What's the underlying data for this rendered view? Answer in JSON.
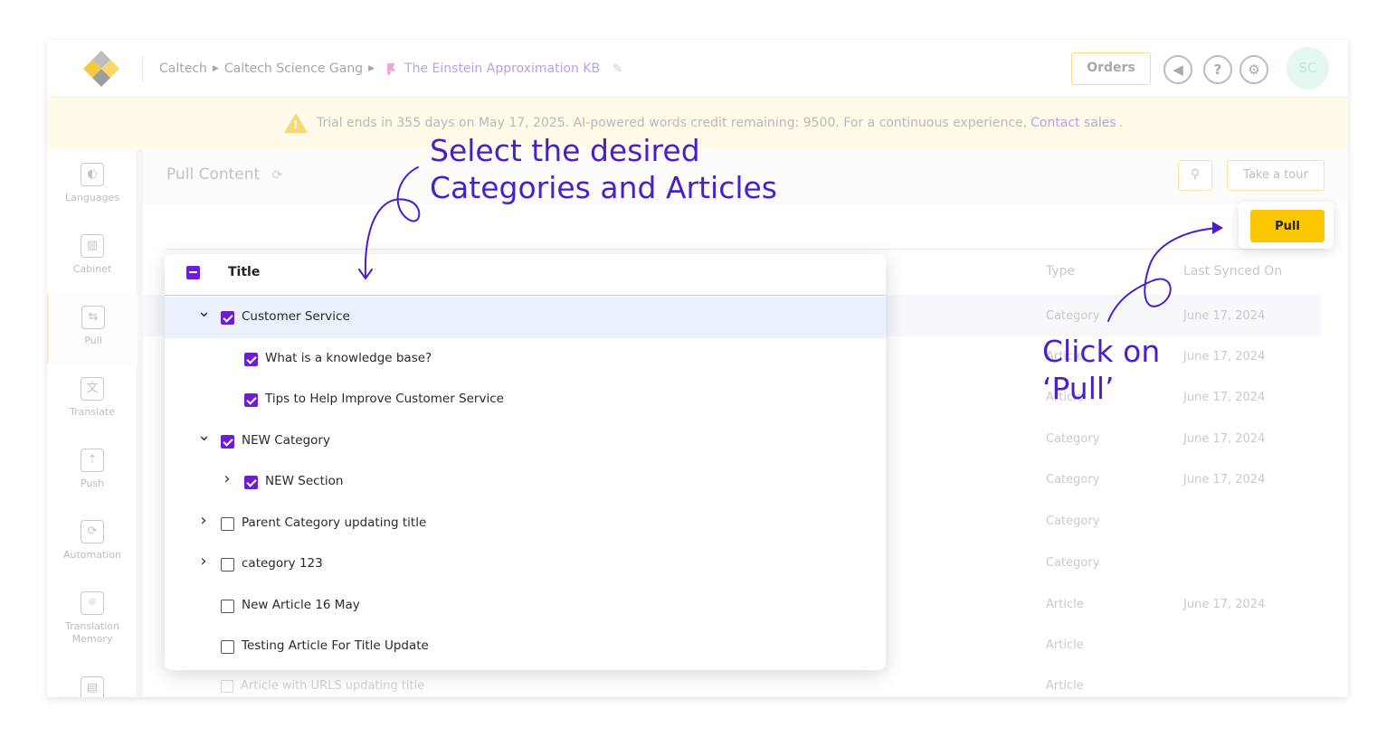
{
  "header": {
    "breadcrumb": [
      "Caltech",
      "Caltech Science Gang"
    ],
    "kb_name": "The Einstein Approximation KB",
    "orders_label": "Orders",
    "avatar_initials": "SC"
  },
  "banner": {
    "text": "Trial ends in 355 days on May 17, 2025. AI-powered words credit remaining: 9500. For a continuous experience,",
    "link": "Contact sales",
    "suffix": "."
  },
  "sidebar": {
    "items": [
      {
        "label": "Languages",
        "icon": "languages-icon"
      },
      {
        "label": "Cabinet",
        "icon": "cabinet-icon"
      },
      {
        "label": "Pull",
        "icon": "pull-icon"
      },
      {
        "label": "Translate",
        "icon": "translate-icon"
      },
      {
        "label": "Push",
        "icon": "push-icon"
      },
      {
        "label": "Automation",
        "icon": "automation-icon"
      },
      {
        "label": "Translation Memory",
        "icon": "translation-memory-icon"
      }
    ]
  },
  "main": {
    "title": "Pull Content",
    "take_tour_label": "Take a tour",
    "pull_label": "Pull",
    "columns": {
      "title": "Title",
      "type": "Type",
      "last_synced": "Last Synced On"
    },
    "rows": [
      {
        "title": "Customer Service",
        "type": "Category",
        "synced": "June 17, 2024",
        "checked": true,
        "expand": "down"
      },
      {
        "title": "What is a knowledge base?",
        "type": "Article",
        "synced": "June 17, 2024",
        "checked": true,
        "expand": "none"
      },
      {
        "title": "Tips to Help Improve Customer Service",
        "type": "Article",
        "synced": "June 17, 2024",
        "checked": true,
        "expand": "none"
      },
      {
        "title": "NEW Category",
        "type": "Category",
        "synced": "June 17, 2024",
        "checked": true,
        "expand": "down"
      },
      {
        "title": "NEW Section",
        "type": "Category",
        "synced": "June 17, 2024",
        "checked": true,
        "expand": "right"
      },
      {
        "title": "Parent Category updating title",
        "type": "Category",
        "synced": "",
        "checked": false,
        "expand": "right"
      },
      {
        "title": "category 123",
        "type": "Category",
        "synced": "",
        "checked": false,
        "expand": "right"
      },
      {
        "title": "New Article 16 May",
        "type": "Article",
        "synced": "June 17, 2024",
        "checked": false,
        "expand": "none"
      },
      {
        "title": "Testing Article For Title Update",
        "type": "Article",
        "synced": "",
        "checked": false,
        "expand": "none"
      },
      {
        "title": "Article with URLS updating title",
        "type": "Article",
        "synced": "",
        "checked": false,
        "expand": "none"
      }
    ]
  },
  "annotations": {
    "select_line1": "Select the desired",
    "select_line2": "Categories and Articles",
    "click_line1": "Click on",
    "click_line2": "‘Pull’"
  },
  "colors": {
    "accent": "#6b1fd0",
    "pull_button": "#fbc700",
    "annotation": "#4a1fc7",
    "banner_bg": "#fffbe8"
  }
}
